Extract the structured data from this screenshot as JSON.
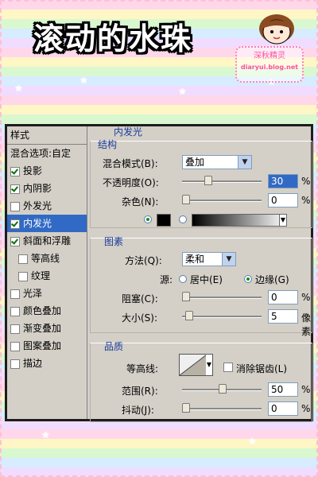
{
  "page": {
    "title": "滚动的水珠",
    "stamp": {
      "line1": "深秋精灵",
      "line2": "diaryui.blog.net"
    }
  },
  "left_panel": {
    "header": "样式",
    "items": [
      {
        "label": "混合选项:自定",
        "checked": null,
        "selected": false
      },
      {
        "label": "投影",
        "checked": true,
        "selected": false
      },
      {
        "label": "内阴影",
        "checked": true,
        "selected": false
      },
      {
        "label": "外发光",
        "checked": false,
        "selected": false
      },
      {
        "label": "内发光",
        "checked": true,
        "selected": true
      },
      {
        "label": "斜面和浮雕",
        "checked": true,
        "selected": false
      },
      {
        "label": "等高线",
        "checked": false,
        "selected": false,
        "indent": true
      },
      {
        "label": "纹理",
        "checked": false,
        "selected": false,
        "indent": true
      },
      {
        "label": "光泽",
        "checked": false,
        "selected": false
      },
      {
        "label": "颜色叠加",
        "checked": false,
        "selected": false
      },
      {
        "label": "渐变叠加",
        "checked": false,
        "selected": false
      },
      {
        "label": "图案叠加",
        "checked": false,
        "selected": false
      },
      {
        "label": "描边",
        "checked": false,
        "selected": false
      }
    ]
  },
  "inner_glow": {
    "section": "内发光",
    "structure": {
      "title": "结构",
      "blend_mode_label": "混合模式(B):",
      "blend_mode_value": "叠加",
      "opacity_label": "不透明度(O):",
      "opacity_value": "30",
      "opacity_unit": "%",
      "opacity_level": 0.3,
      "noise_label": "杂色(N):",
      "noise_value": "0",
      "noise_unit": "%",
      "noise_level": 0.0
    },
    "elements": {
      "title": "图素",
      "method_label": "方法(Q):",
      "method_value": "柔和",
      "source_label": "源:",
      "source_center": "居中(E)",
      "source_edge": "边缘(G)",
      "source_selected": "edge",
      "choke_label": "阻塞(C):",
      "choke_value": "0",
      "choke_unit": "%",
      "choke_level": 0.0,
      "size_label": "大小(S):",
      "size_value": "5",
      "size_unit": "像素",
      "size_level": 0.04
    },
    "quality": {
      "title": "品质",
      "contour_label": "等高线:",
      "antialias_label": "消除锯齿(L)",
      "antialias_checked": false,
      "range_label": "范围(R):",
      "range_value": "50",
      "range_unit": "%",
      "range_level": 0.5,
      "jitter_label": "抖动(J):",
      "jitter_value": "0",
      "jitter_unit": "%",
      "jitter_level": 0.0
    }
  }
}
